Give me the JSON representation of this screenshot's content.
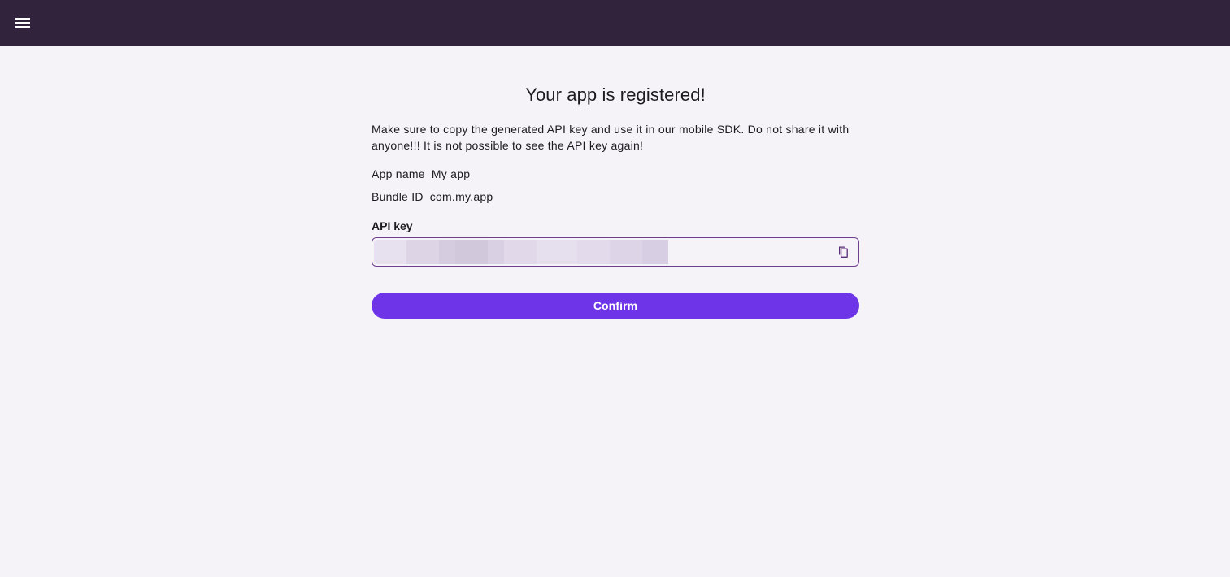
{
  "header": {
    "menu_icon": "hamburger-menu-icon",
    "background": "#31233c"
  },
  "main": {
    "title": "Your app is registered!",
    "description": "Make sure to copy the generated API key and use it in our mobile SDK. Do not share it with anyone!!! It is not possible to see the API key again!",
    "app_name_label": "App name",
    "app_name_value": "My app",
    "bundle_id_label": "Bundle ID",
    "bundle_id_value": "com.my.app",
    "api_key_label": "API key",
    "api_key_value": "",
    "copy_icon": "copy-icon",
    "confirm_label": "Confirm"
  },
  "colors": {
    "accent": "#6e35e8",
    "background": "#f5f2f8",
    "field_border": "#6e3f8f"
  }
}
